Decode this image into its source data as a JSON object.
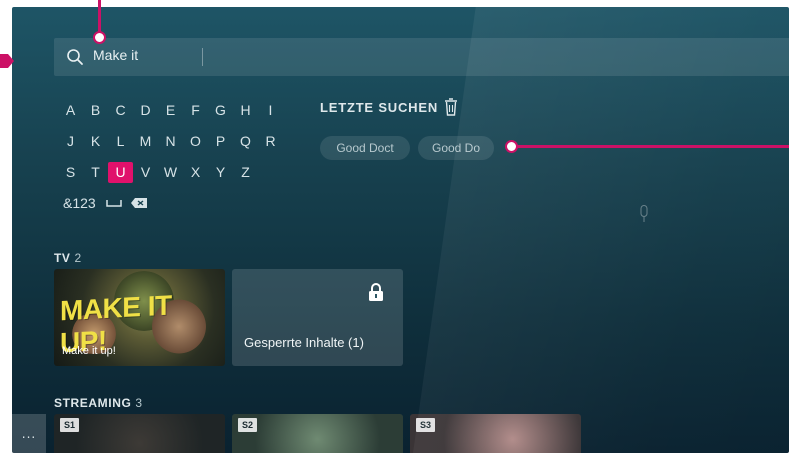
{
  "search": {
    "query": "Make it"
  },
  "keyboard": {
    "rows": [
      [
        "A",
        "B",
        "C",
        "D",
        "E",
        "F",
        "G",
        "H",
        "I"
      ],
      [
        "J",
        "K",
        "L",
        "M",
        "N",
        "O",
        "P",
        "Q",
        "R"
      ],
      [
        "S",
        "T",
        "U",
        "V",
        "W",
        "X",
        "Y",
        "Z"
      ]
    ],
    "active_key": "U",
    "symbols_label": "&123"
  },
  "recent": {
    "title": "LETZTE SUCHEN",
    "items": [
      "Good Doct",
      "Good Do"
    ]
  },
  "tv": {
    "label": "TV",
    "count": "2",
    "poster_title": "MAKE IT UP!",
    "poster_caption": "Make it up!",
    "locked_label": "Gesperrte Inhalte (1)"
  },
  "streaming": {
    "label": "STREAMING",
    "count": "3",
    "more_label": "...",
    "items": [
      "S1",
      "S2",
      "S3"
    ]
  },
  "colors": {
    "accent": "#e0116b",
    "annotation": "#cc1166",
    "background": "#17414f"
  },
  "icons": [
    "search-icon",
    "trash-icon",
    "space-icon",
    "backspace-icon",
    "mic-icon",
    "lock-icon"
  ]
}
